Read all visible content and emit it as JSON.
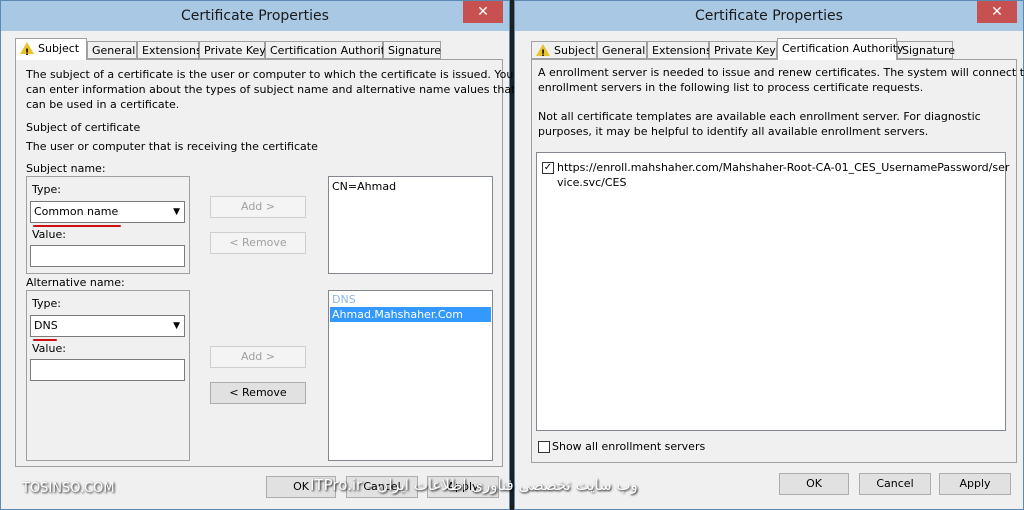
{
  "left_dialog": {
    "title": "Certificate Properties",
    "close_label": "✕",
    "tabs": [
      "Subject",
      "General",
      "Extensions",
      "Private Key",
      "Certification Authority",
      "Signature"
    ],
    "description": [
      "The subject of a certificate is the user or computer to which the certificate is issued. You",
      "can enter information about the types of subject name and alternative name values that",
      "can be used in a certificate."
    ],
    "subject_of_certificate_label": "Subject of certificate",
    "subject_of_certificate_value": "The user or computer that is receiving the certificate",
    "subject_name_label": "Subject name:",
    "type_label": "Type:",
    "subject_type_value": "Common name",
    "value_label": "Value:",
    "add_label": "Add >",
    "remove_label": "< Remove",
    "subject_list": [
      "CN=Ahmad"
    ],
    "alternative_name_label": "Alternative name:",
    "alt_type_value": "DNS",
    "alt_list_header": "DNS",
    "alt_list_selected": "Ahmad.Mahshaher.Com",
    "ok_label": "OK",
    "cancel_label": "Cancel",
    "apply_label": "Apply"
  },
  "right_dialog": {
    "title": "Certificate Properties",
    "close_label": "✕",
    "tabs": [
      "Subject",
      "General",
      "Extensions",
      "Private Key",
      "Certification Authority",
      "Signature"
    ],
    "description1": [
      "A enrollment server is needed to issue and renew certificates. The system will connect to",
      "enrollment servers in the following list to process certificate requests."
    ],
    "description2": [
      "Not all certificate templates are available each enrollment server. For diagnostic",
      "purposes, it may be helpful to identify all available enrollment servers."
    ],
    "server_url": [
      "https://enroll.mahshaher.com/Mahshaher-Root-CA-01_CES_UsernamePassword/ser",
      "vice.svc/CES"
    ],
    "show_all_label": "Show all enrollment servers",
    "ok_label": "OK",
    "cancel_label": "Cancel",
    "apply_label": "Apply"
  },
  "watermark": {
    "left": "TOSINSO.COM",
    "center": "ITPro.ir - وب سایت تخصصی فناوری اطلاعات ایران"
  },
  "colors": {
    "accent": "#a9c8e4",
    "selection": "#3399ff",
    "close": "#c75050",
    "underline": "#d01010"
  }
}
